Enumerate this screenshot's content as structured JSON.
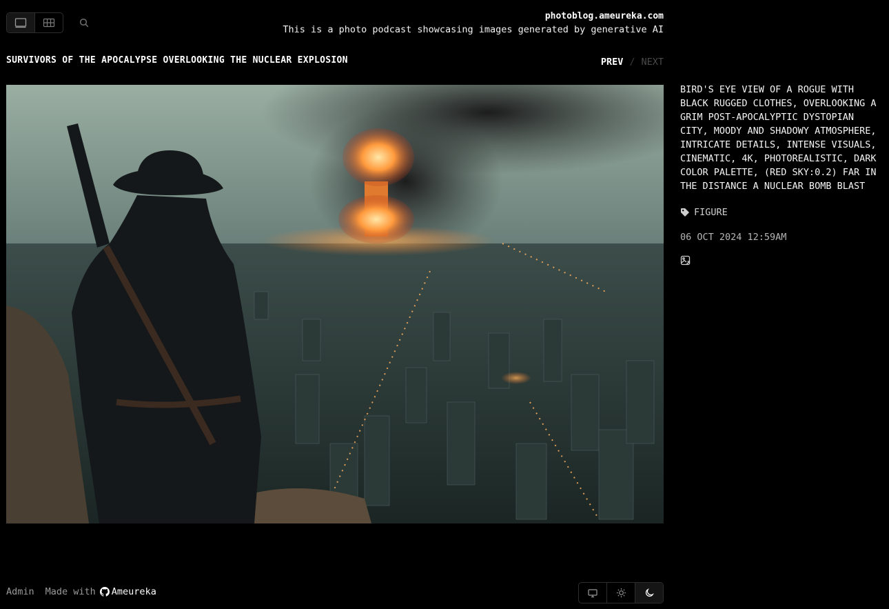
{
  "header": {
    "domain": "photoblog.ameureka.com",
    "tagline": "This is a photo podcast showcasing images generated by generative AI",
    "view_modes": [
      "full-view",
      "grid-view"
    ],
    "active_view": "full-view"
  },
  "photo": {
    "title": "SURVIVORS OF THE APOCALYPSE OVERLOOKING THE NUCLEAR EXPLOSION",
    "caption": "BIRD'S EYE VIEW OF A ROGUE WITH\nBLACK RUGGED CLOTHES, OVERLOOKING A\nGRIM POST-APOCALYPTIC DYSTOPIAN\nCITY, MOODY AND SHADOWY ATMOSPHERE,\nINTRICATE DETAILS, INTENSE VISUALS,\nCINEMATIC, 4K, PHOTOREALISTIC, DARK\nCOLOR PALETTE, (RED SKY:0.2) FAR IN\nTHE DISTANCE A NUCLEAR BOMB BLAST",
    "tag": "FIGURE",
    "date": "06 OCT 2024 12:59AM"
  },
  "pager": {
    "prev": "PREV",
    "separator": "/",
    "next": "NEXT"
  },
  "footer": {
    "admin": "Admin",
    "made_with": "Made with",
    "brand": "Ameureka"
  },
  "theme": {
    "options": [
      "system",
      "light",
      "dark"
    ],
    "active": "dark"
  },
  "colors": {
    "background": "#000000",
    "text": "#ffffff",
    "muted": "#9a9a9a",
    "border": "#2e2e2e"
  }
}
